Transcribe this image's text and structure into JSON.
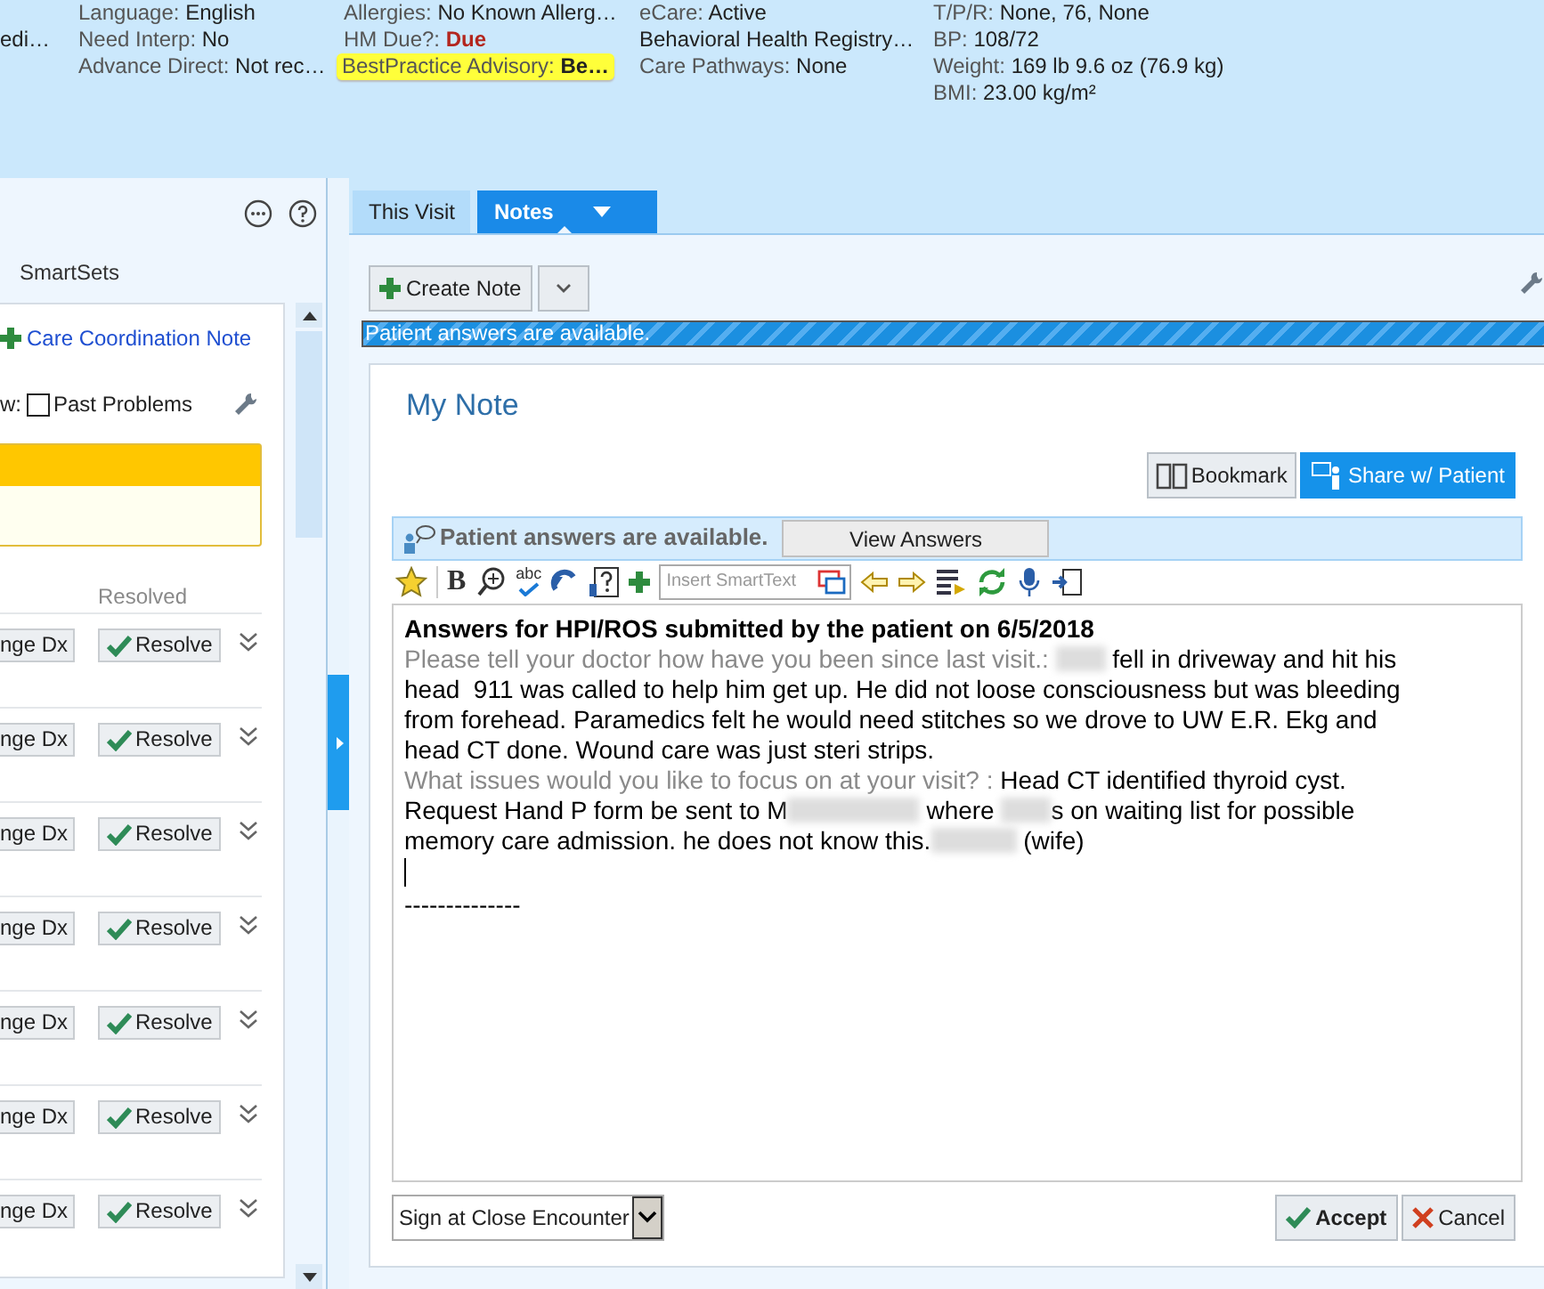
{
  "patient_header": {
    "columns": [
      [
        {
          "kind": "plain",
          "value": "edi…"
        }
      ],
      [
        {
          "kind": "plain",
          "label": "Language:",
          "value": "English"
        },
        {
          "kind": "plain",
          "label": "Need Interp:",
          "value": "No"
        },
        {
          "kind": "plain",
          "label": "Advance Direct:",
          "value": "Not rec…"
        }
      ],
      [
        {
          "kind": "plain",
          "label": "Allergies:",
          "value": "No Known Allerg…"
        },
        {
          "kind": "alert",
          "label": "HM Due?:",
          "value": "Due"
        },
        {
          "kind": "advisory",
          "label": "BestPractice Advisory:",
          "value": "Be…"
        }
      ],
      [
        {
          "kind": "plain",
          "label": "eCare:",
          "value": "Active"
        },
        {
          "kind": "plain",
          "value": "Behavioral Health Registry…"
        },
        {
          "kind": "plain",
          "label": "Care Pathways:",
          "value": "None"
        }
      ],
      [
        {
          "kind": "plain",
          "label": "T/P/R:",
          "value": "None, 76, None"
        },
        {
          "kind": "plain",
          "label": "BP:",
          "value": "108/72"
        },
        {
          "kind": "plain",
          "label": "Weight:",
          "value": "169 lb 9.6 oz (76.9 kg)"
        },
        {
          "kind": "plain",
          "label": "BMI:",
          "value": "23.00 kg/m²"
        }
      ]
    ]
  },
  "sidebar": {
    "section_title": "SmartSets",
    "add_link": "Care Coordination Note",
    "filter_prefix": "w:",
    "past_problems": {
      "label": "Past Problems",
      "checked": false
    },
    "resolved_header": "Resolved",
    "problem_rows": [
      {
        "change_dx": "nge Dx",
        "resolve": "Resolve"
      },
      {
        "change_dx": "nge Dx",
        "resolve": "Resolve"
      },
      {
        "change_dx": "nge Dx",
        "resolve": "Resolve"
      },
      {
        "change_dx": "nge Dx",
        "resolve": "Resolve"
      },
      {
        "change_dx": "nge Dx",
        "resolve": "Resolve"
      },
      {
        "change_dx": "nge Dx",
        "resolve": "Resolve"
      },
      {
        "change_dx": "nge Dx",
        "resolve": "Resolve"
      }
    ]
  },
  "tabs": [
    {
      "label": "This Visit",
      "selected": false
    },
    {
      "label": "Notes",
      "selected": true
    }
  ],
  "create_note_button": "Create Note",
  "banner": "Patient answers are available.",
  "note": {
    "title": "My Note",
    "bookmark_button": "Bookmark",
    "share_button": "Share w/ Patient",
    "answers_bar": {
      "text": "Patient answers are available.",
      "button": "View Answers"
    },
    "toolbar": {
      "bold": "B",
      "spell": "abc",
      "smarttext_placeholder": "Insert SmartText"
    },
    "heading": "Answers for HPI/ROS submitted by the patient on 6/5/2018",
    "answers": [
      {
        "prompt": "Please tell your doctor how have you been since last visit.: ",
        "segments": [
          {
            "kind": "redacted_short"
          },
          {
            "kind": "text",
            "text": " fell in driveway and hit his head  911 was called to help him get up. He did not loose consciousness but was bleeding from forehead. Paramedics felt he would need stitches so we drove to UW E.R. Ekg and head CT done. Wound care was just steri strips."
          }
        ]
      },
      {
        "prompt": "What issues would you like to focus on at your visit? : ",
        "segments": [
          {
            "kind": "text",
            "text": "Head CT identified thyroid cyst. Request Hand P form be sent to M"
          },
          {
            "kind": "redacted_long"
          },
          {
            "kind": "text",
            "text": " where "
          },
          {
            "kind": "redacted_short"
          },
          {
            "kind": "text",
            "text": "s on waiting list for possible memory care admission. he does not know this."
          },
          {
            "kind": "redacted_medium"
          },
          {
            "kind": "text",
            "text": " (wife)"
          }
        ]
      }
    ],
    "separator": "--------------",
    "sign_select": "Sign at Close Encounter",
    "accept_button": "Accept",
    "cancel_button": "Cancel"
  }
}
